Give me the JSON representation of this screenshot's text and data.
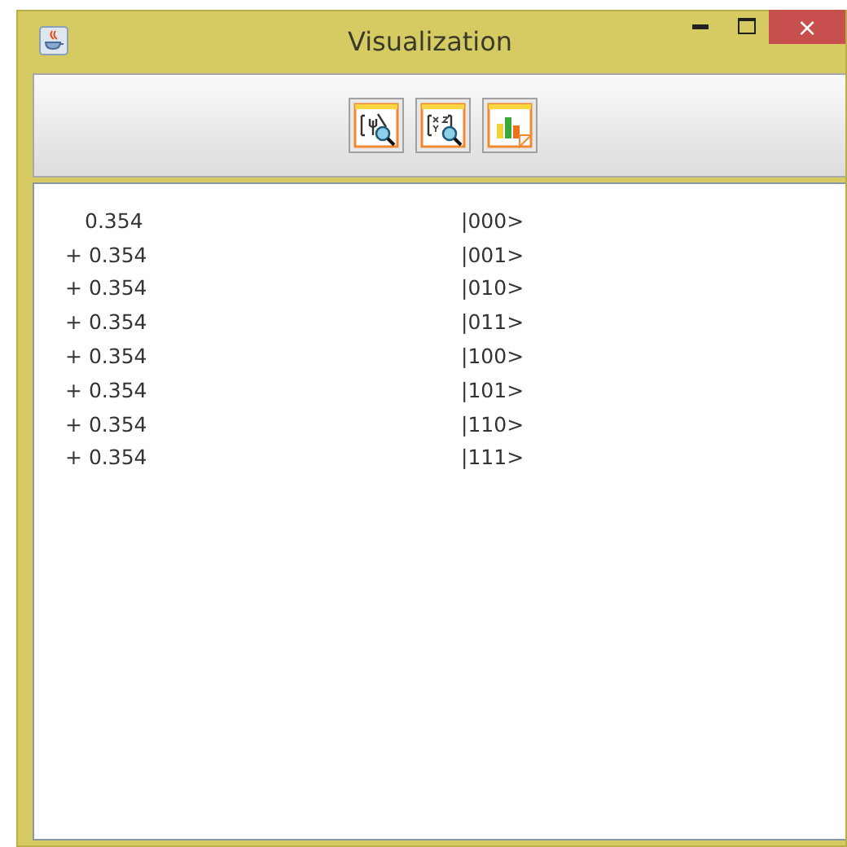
{
  "window": {
    "title": "Visualization",
    "close": "×"
  },
  "toolbar": {
    "buttons": [
      {
        "kind": "state"
      },
      {
        "kind": "matrix"
      },
      {
        "kind": "chart"
      }
    ]
  },
  "terms": [
    {
      "amplitude": "0.354",
      "ket": "|000>"
    },
    {
      "sign": "+",
      "amplitude": "0.354",
      "ket": "|001>"
    },
    {
      "sign": "+",
      "amplitude": "0.354",
      "ket": "|010>"
    },
    {
      "sign": "+",
      "amplitude": "0.354",
      "ket": "|011>"
    },
    {
      "sign": "+",
      "amplitude": "0.354",
      "ket": "|100>"
    },
    {
      "sign": "+",
      "amplitude": "0.354",
      "ket": "|101>"
    },
    {
      "sign": "+",
      "amplitude": "0.354",
      "ket": "|110>"
    },
    {
      "sign": "+",
      "amplitude": "0.354",
      "ket": "|111>"
    }
  ]
}
